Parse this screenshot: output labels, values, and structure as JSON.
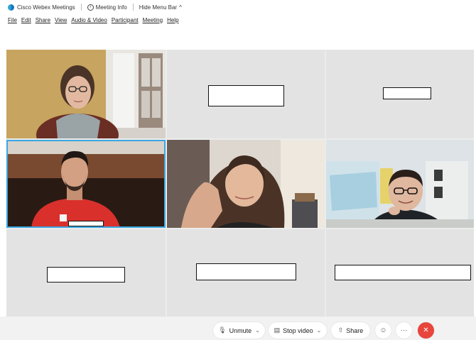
{
  "titlebar": {
    "app_name": "Cisco Webex Meetings",
    "meeting_info": "Meeting Info",
    "hide_menu_bar": "Hide Menu Bar"
  },
  "menu": [
    "File",
    "Edit",
    "Share",
    "View",
    "Audio & Video",
    "Participant",
    "Meeting",
    "Help"
  ],
  "controls": {
    "unmute": "Unmute",
    "stop_video": "Stop video",
    "share": "Share",
    "more": "···",
    "end": "✕"
  },
  "colors": {
    "active_border": "#3aa7e0",
    "end_button": "#e8453c",
    "logo": "#1a73b8"
  },
  "icons": {
    "mic": "microphone-muted-icon",
    "video": "video-camera-icon",
    "share": "share-icon",
    "reactions": "smiley-icon",
    "more": "more-icon",
    "end": "close-icon"
  }
}
